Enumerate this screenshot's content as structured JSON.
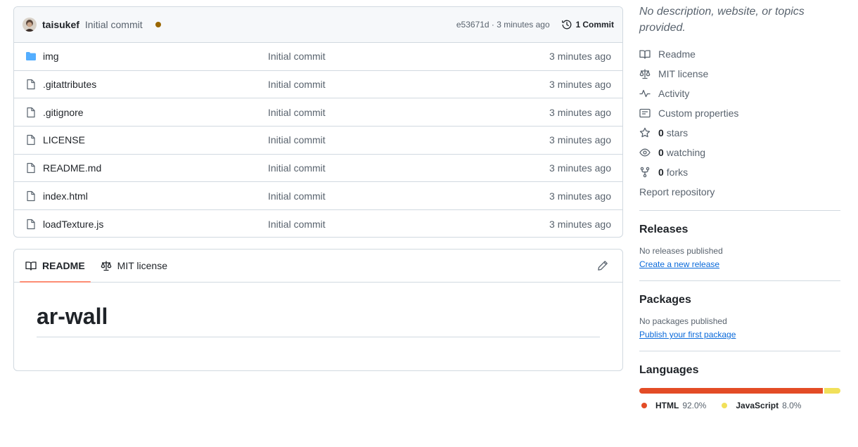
{
  "latest_commit": {
    "author": "taisukef",
    "message": "Initial commit",
    "status": "pending",
    "meta": "e53671d · 3 minutes ago",
    "commit_count": "1",
    "commits_label": "Commit"
  },
  "files": [
    {
      "name": "img",
      "type": "folder",
      "message": "Initial commit",
      "age": "3 minutes ago"
    },
    {
      "name": ".gitattributes",
      "type": "file",
      "message": "Initial commit",
      "age": "3 minutes ago"
    },
    {
      "name": ".gitignore",
      "type": "file",
      "message": "Initial commit",
      "age": "3 minutes ago"
    },
    {
      "name": "LICENSE",
      "type": "file",
      "message": "Initial commit",
      "age": "3 minutes ago"
    },
    {
      "name": "README.md",
      "type": "file",
      "message": "Initial commit",
      "age": "3 minutes ago"
    },
    {
      "name": "index.html",
      "type": "file",
      "message": "Initial commit",
      "age": "3 minutes ago"
    },
    {
      "name": "loadTexture.js",
      "type": "file",
      "message": "Initial commit",
      "age": "3 minutes ago"
    }
  ],
  "readme": {
    "tabs": [
      {
        "label": "README",
        "icon": "book-icon",
        "active": true
      },
      {
        "label": "MIT license",
        "icon": "law-icon",
        "active": false
      }
    ],
    "heading": "ar-wall"
  },
  "about": {
    "description": "No description, website, or topics provided.",
    "readme_label": "Readme",
    "license_label": "MIT license",
    "activity_label": "Activity",
    "custom_props_label": "Custom properties",
    "stars_count": "0",
    "stars_label": "stars",
    "watching_count": "0",
    "watching_label": "watching",
    "forks_count": "0",
    "forks_label": "forks",
    "report_label": "Report repository"
  },
  "releases": {
    "title": "Releases",
    "empty_text": "No releases published",
    "link": "Create a new release"
  },
  "packages": {
    "title": "Packages",
    "empty_text": "No packages published",
    "link": "Publish your first package"
  },
  "languages": {
    "title": "Languages",
    "items": [
      {
        "name": "HTML",
        "percent": "92.0%",
        "value": 92.0,
        "color": "#e34c26"
      },
      {
        "name": "JavaScript",
        "percent": "8.0%",
        "value": 8.0,
        "color": "#f1e05a"
      }
    ]
  },
  "colors": {
    "accent_link": "#0969da",
    "active_tab_underline": "#fd8c73",
    "folder_icon": "#54aeff",
    "status_dot": "#9a6700"
  }
}
